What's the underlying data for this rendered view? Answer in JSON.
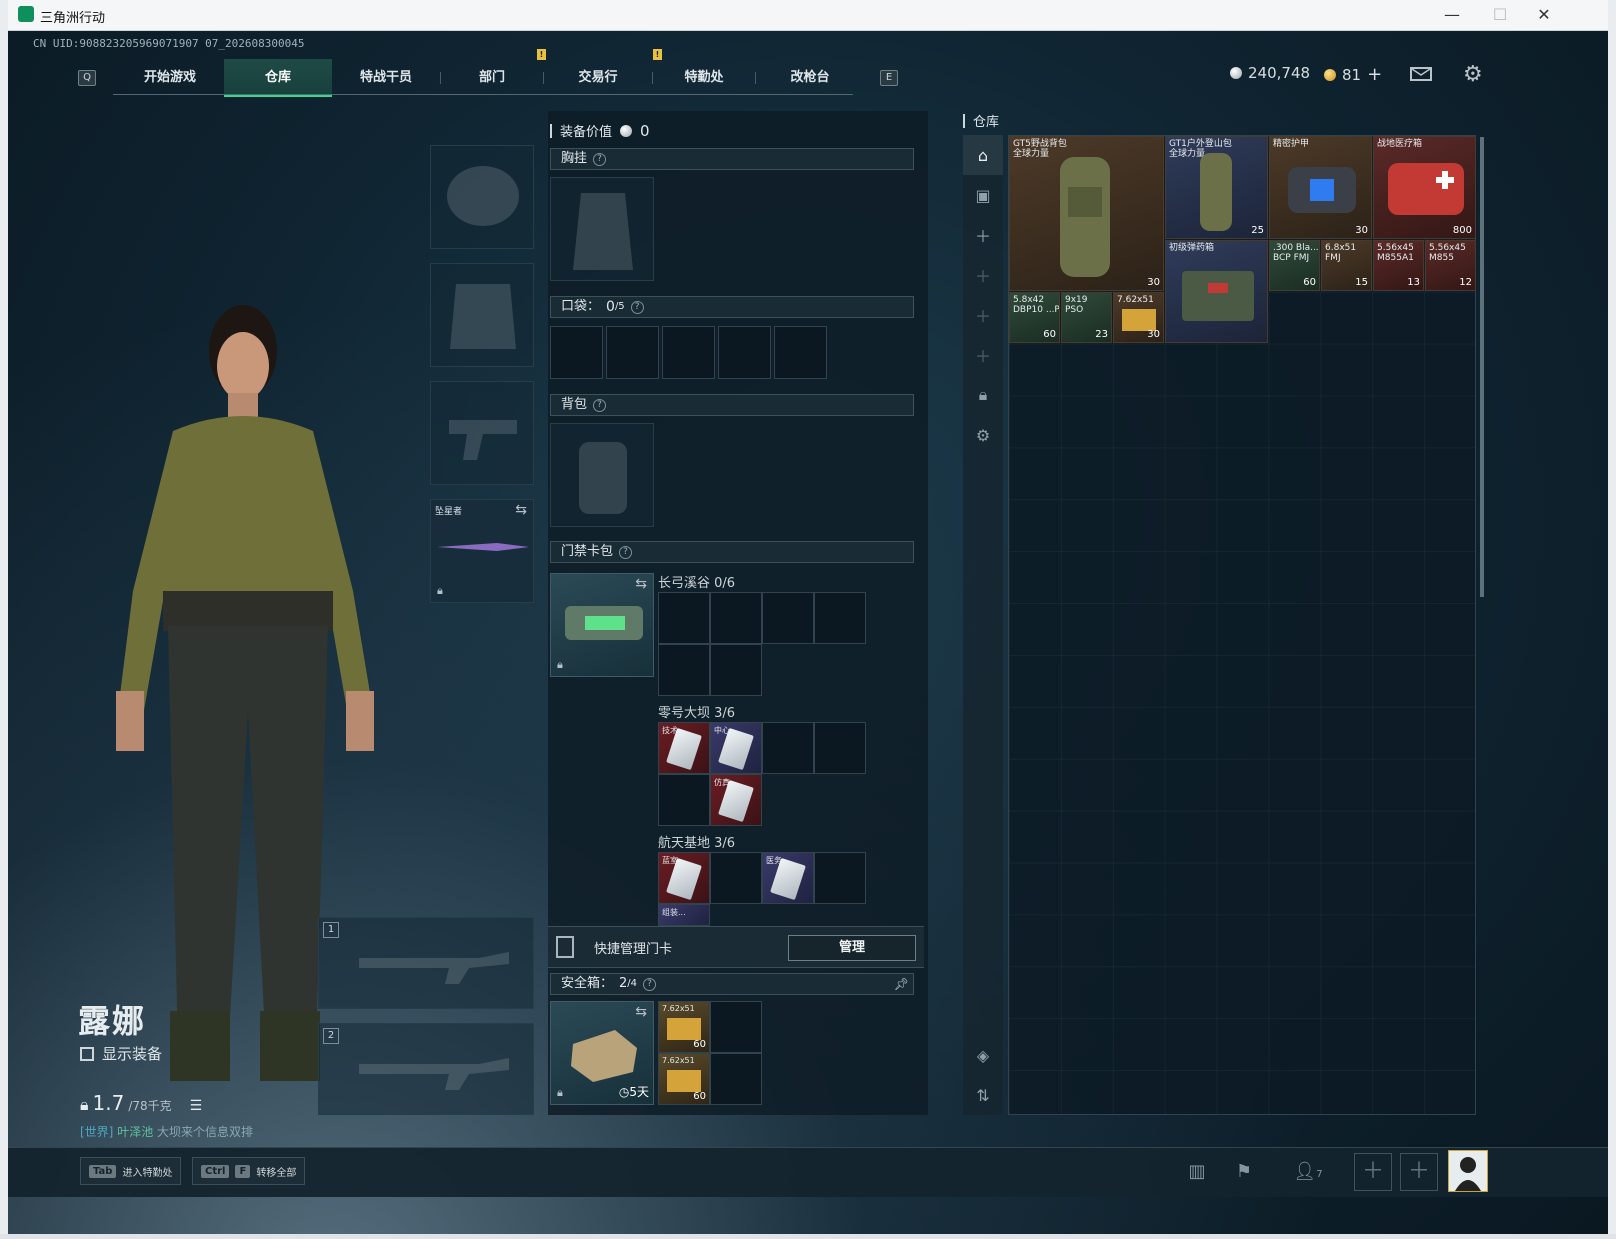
{
  "window": {
    "title": "三角洲行动",
    "controls": {
      "minimize": "—",
      "maximize": "☐",
      "close": "✕"
    }
  },
  "uid": "CN UID:908823205969071907 07_202608300045",
  "nav": {
    "left_key": "Q",
    "right_key": "E",
    "tabs": [
      "开始游戏",
      "仓库",
      "特战干员",
      "部门",
      "交易行",
      "特勤处",
      "改枪台"
    ],
    "badge": "!",
    "active_index": 1
  },
  "currency": {
    "silver": "240,748",
    "gold": "81",
    "add": "+"
  },
  "character": {
    "name": "露娜",
    "show_gear_label": "显示装备",
    "weight": "1.7",
    "weight_cap": "/78千克"
  },
  "chat": {
    "channel": "[世界]",
    "user": "叶泽池",
    "text": "大坝来个信息双排"
  },
  "equipment": {
    "melee_label": "坠星者",
    "weapon_slots": [
      "1",
      "2"
    ]
  },
  "gear": {
    "value_label": "装备价值",
    "value": "0",
    "chest_rig": "胸挂",
    "pockets_label": "口袋：",
    "pockets_count": "0",
    "pockets_cap": "/5",
    "backpack": "背包",
    "keycard_case": "门禁卡包",
    "maps": [
      {
        "name": "长弓溪谷",
        "count": "0/6"
      },
      {
        "name": "零号大坝",
        "count": "3/6"
      },
      {
        "name": "航天基地",
        "count": "3/6"
      }
    ],
    "dam_cards": [
      "技术...",
      "中心...",
      "仿真..."
    ],
    "space_cards": [
      "蓝室...",
      "医务...",
      "组装..."
    ],
    "quick_manage": "快捷管理门卡",
    "manage_btn": "管理",
    "safebox_label": "安全箱：",
    "safebox_count": "2",
    "safebox_cap": "/4",
    "safebox_days": "5天",
    "safebox_items": [
      {
        "name": "7.62x51",
        "qty": "60"
      },
      {
        "name": "7.62x51",
        "qty": "60"
      }
    ]
  },
  "warehouse": {
    "title": "仓库",
    "items": [
      {
        "name": "GT5野战背包",
        "sub": "全球力量",
        "qty": "30"
      },
      {
        "name": "GT1户外登山包",
        "sub": "全球力量",
        "qty": "25"
      },
      {
        "name": "精密护甲",
        "sub": "",
        "qty": "30"
      },
      {
        "name": "战地医疗箱",
        "sub": "",
        "qty": "800"
      },
      {
        "name": "初级弹药箱",
        "sub": "",
        "qty": ""
      },
      {
        "name": ".300 Bla...",
        "sub": "BCP FMJ",
        "qty": "60"
      },
      {
        "name": "6.8x51",
        "sub": "FMJ",
        "qty": "15"
      },
      {
        "name": "5.56x45",
        "sub": "M855A1",
        "qty": "13"
      },
      {
        "name": "5.56x45",
        "sub": "M855",
        "qty": "12"
      },
      {
        "name": "5.8x42",
        "sub": "DBP10 ...P",
        "qty": "60"
      },
      {
        "name": "9x19",
        "sub": "PSO",
        "qty": "23"
      },
      {
        "name": "7.62x51",
        "sub": "",
        "qty": "30"
      }
    ]
  },
  "bottom": {
    "hint1_key": "Tab",
    "hint1": "进入特勤处",
    "hint2_keys": [
      "Ctrl",
      "F"
    ],
    "hint2": "转移全部",
    "friends_count": "7"
  },
  "colors": {
    "accent": "#38d98f",
    "badge": "#e8c23a",
    "bg": "#0f2330"
  },
  "icons": [
    "app-logo-icon",
    "coin-icon",
    "mail-icon",
    "gear-icon",
    "lock-icon",
    "swap-icon",
    "clock-icon",
    "chart-icon",
    "flag-icon",
    "friends-icon",
    "plus-icon",
    "layers-icon"
  ]
}
